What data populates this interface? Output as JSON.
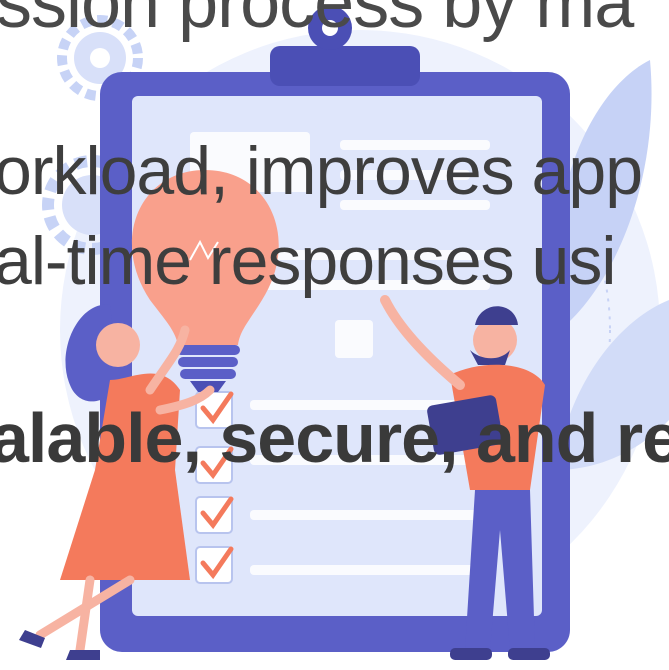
{
  "text_lines": {
    "line1": "ssion process by ma",
    "line2": "orkload, improves app",
    "line3": "al-time responses usi",
    "line4": "alable, secure, and re"
  },
  "colors": {
    "ink": "#3e3e3e",
    "clipboard_frame": "#5b5fc7",
    "paper": "#dfe6fb",
    "accent": "#f47a5c",
    "bulb": "#f9a08c",
    "background_blob": "#eef2fd"
  },
  "icons": [
    "gear-icon",
    "leaf-icon",
    "lightbulb-icon",
    "checkbox-icon"
  ]
}
